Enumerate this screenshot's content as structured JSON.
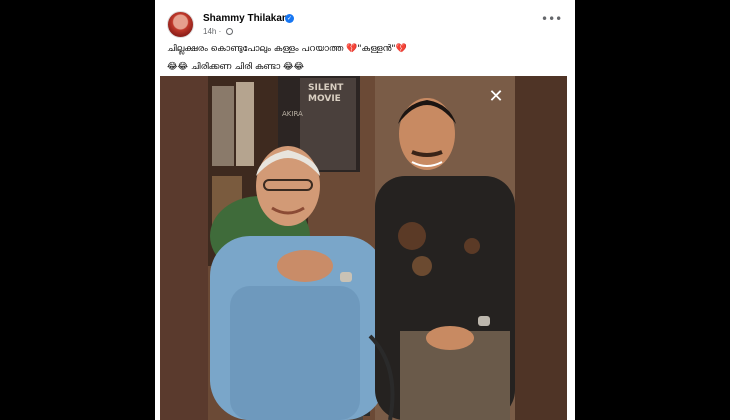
{
  "post": {
    "author": "Shammy Thilakan",
    "time": "14h",
    "caption_line1": "ചില്ലക്ഷരം കൊണ്ടുപോലും കള്ളം പറയാത്ത 💔\"കള്ളൻ\"💔",
    "caption_line2": "😂😂 ചിരിക്കണ ചിരി കണ്ടാ 😂😂",
    "more_label": "•••",
    "close_label": "✕"
  },
  "photo": {
    "poster_text_top": "SILENT",
    "poster_text_movie": "MOVIE",
    "poster_text_side": "AKIRA"
  },
  "colors": {
    "accent": "#1877f2",
    "photo_bg": "#5d3a2c"
  }
}
